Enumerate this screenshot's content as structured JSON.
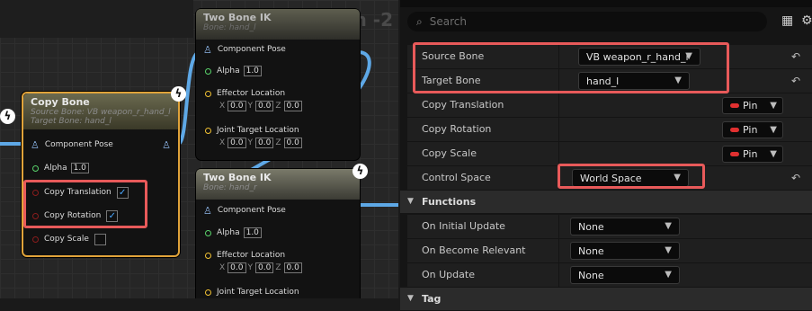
{
  "graph": {
    "zoom_label": "Zoom -2",
    "nodes": {
      "copy_bone": {
        "title": "Copy Bone",
        "subtitle1": "Source Bone: VB weapon_r_hand_l",
        "subtitle2": "Target Bone: hand_l",
        "component_pose": "Component Pose",
        "alpha_label": "Alpha",
        "alpha_value": "1.0",
        "copy_translation": "Copy Translation",
        "copy_rotation": "Copy Rotation",
        "copy_scale": "Copy Scale",
        "check": "✓"
      },
      "ik1": {
        "title": "Two Bone IK",
        "subtitle": "Bone: hand_l",
        "component_pose": "Component Pose",
        "alpha_label": "Alpha",
        "alpha_value": "1.0",
        "effector_location": "Effector Location",
        "joint_target_location": "Joint Target Location",
        "x": "X",
        "y": "Y",
        "z": "Z",
        "v": "0.0"
      },
      "ik2": {
        "title": "Two Bone IK",
        "subtitle": "Bone: hand_r",
        "component_pose": "Component Pose",
        "alpha_label": "Alpha",
        "alpha_value": "1.0",
        "effector_location": "Effector Location",
        "joint_target_location": "Joint Target Location"
      }
    },
    "colors": {
      "copy_bone_border": "#e0a33a",
      "wire": "#5ea8e6",
      "highlight": "#e85a5a",
      "alpha_pin": "#59d36b",
      "bool_pin": "#8a1d1d",
      "vector_pin": "#f2c233"
    }
  },
  "details": {
    "search_placeholder": "Search",
    "rows": {
      "source_bone": {
        "label": "Source Bone",
        "value": "VB weapon_r_hand_l"
      },
      "target_bone": {
        "label": "Target Bone",
        "value": "hand_l"
      },
      "copy_translation": {
        "label": "Copy Translation",
        "value": "Pin"
      },
      "copy_rotation": {
        "label": "Copy Rotation",
        "value": "Pin"
      },
      "copy_scale": {
        "label": "Copy Scale",
        "value": "Pin"
      },
      "control_space": {
        "label": "Control Space",
        "value": "World Space"
      }
    },
    "functions_section": "Functions",
    "functions": {
      "on_initial_update": {
        "label": "On Initial Update",
        "value": "None"
      },
      "on_become_relevant": {
        "label": "On Become Relevant",
        "value": "None"
      },
      "on_update": {
        "label": "On Update",
        "value": "None"
      }
    },
    "next_section": "Tag"
  }
}
